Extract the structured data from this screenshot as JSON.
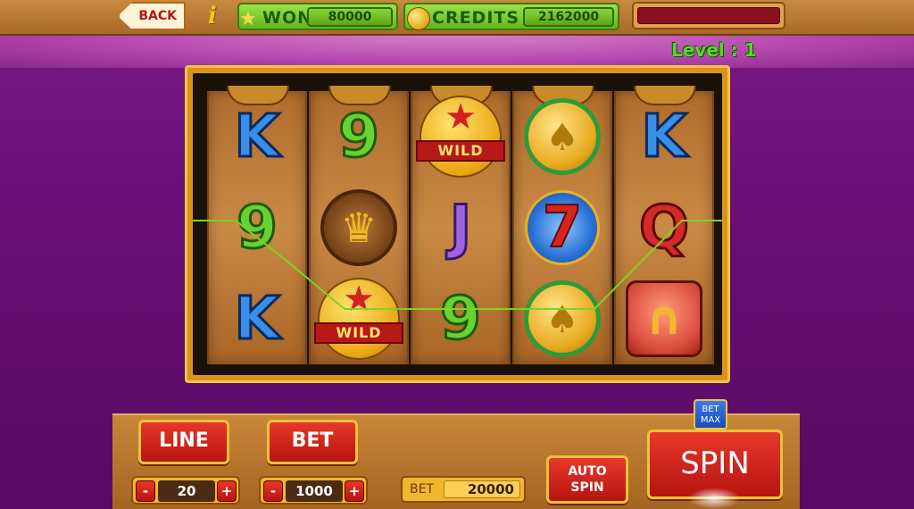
{
  "topbar": {
    "back_label": "BACK",
    "info_icon": "info-icon",
    "won": {
      "label": "WON",
      "value": "80000"
    },
    "credits": {
      "label": "CREDITS",
      "value": "2162000"
    },
    "xp_progress": 0.0
  },
  "level": {
    "text": "Level : 1"
  },
  "reels": [
    {
      "symbols": [
        "K",
        "9",
        "K"
      ]
    },
    {
      "symbols": [
        "9",
        "crown",
        "wild"
      ]
    },
    {
      "symbols": [
        "wild",
        "J",
        "9"
      ]
    },
    {
      "symbols": [
        "spade-coin",
        "7",
        "spade-coin"
      ]
    },
    {
      "symbols": [
        "K",
        "Q",
        "horseshoe"
      ]
    }
  ],
  "wild_label": "WILD",
  "controls": {
    "line": {
      "label": "LINE",
      "value": "20",
      "minus": "-",
      "plus": "+"
    },
    "bet": {
      "label": "BET",
      "value": "1000",
      "minus": "-",
      "plus": "+"
    },
    "total_bet": {
      "label": "BET",
      "value": "20000"
    },
    "auto_spin": {
      "line1": "AUTO",
      "line2": "SPIN"
    },
    "bet_max": {
      "line1": "BET",
      "line2": "MAX"
    },
    "spin_label": "SPIN"
  },
  "colors": {
    "background": "#6a0f78",
    "panel": "#c78638",
    "button_red": "#d42a1e",
    "button_border": "#f2c23a",
    "stat_green": "#7ccd35"
  }
}
